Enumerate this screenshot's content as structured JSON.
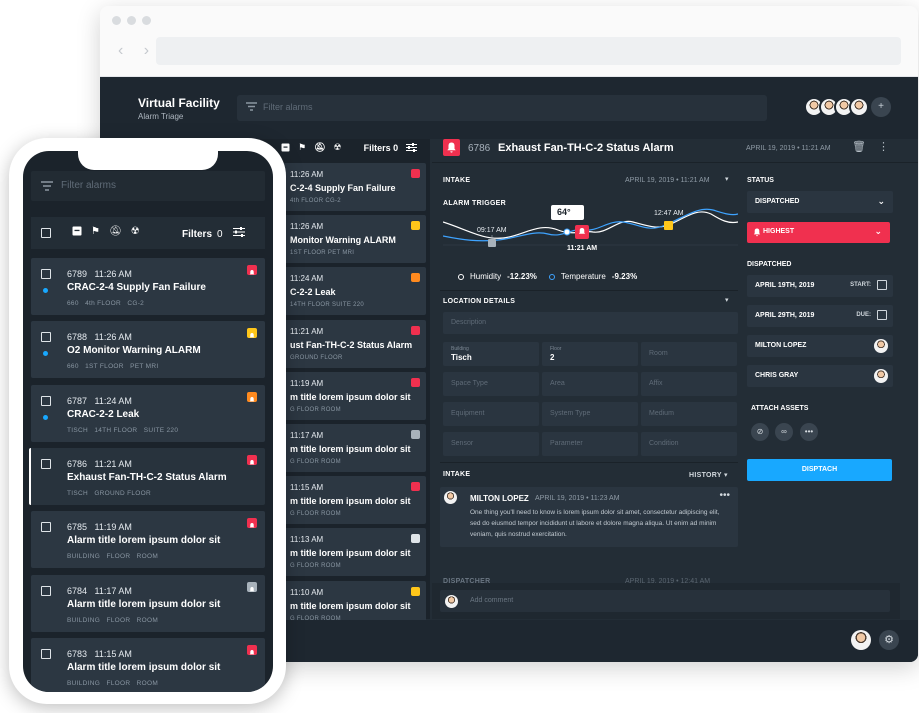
{
  "app": {
    "title": "Virtual Facility",
    "subtitle": "Alarm Triage",
    "filter_placeholder": "Filter alarms"
  },
  "toolbar": {
    "filters_label": "Filters",
    "filters_count": "0"
  },
  "alarms": [
    {
      "id": "6789",
      "time": "11:26 AM",
      "title": "CRAC-2-4 Supply Fan Failure",
      "meta": [
        "660",
        "4th FLOOR",
        "CG-2"
      ],
      "severity": "red",
      "unread": true
    },
    {
      "id": "6788",
      "time": "11:26 AM",
      "title": "O2 Monitor Warning ALARM",
      "meta": [
        "660",
        "1ST FLOOR",
        "PET MRI"
      ],
      "severity": "yellow",
      "unread": true
    },
    {
      "id": "6787",
      "time": "11:24 AM",
      "title": "CRAC-2-2 Leak",
      "meta": [
        "TISCH",
        "14TH FLOOR",
        "SUITE 220"
      ],
      "severity": "orange",
      "unread": true
    },
    {
      "id": "6786",
      "time": "11:21 AM",
      "title": "Exhaust Fan-TH-C-2 Status Alarm",
      "meta": [
        "TISCH",
        "GROUND FLOOR"
      ],
      "severity": "red",
      "unread": false,
      "selected": true
    },
    {
      "id": "6785",
      "time": "11:19 AM",
      "title": "Alarm title lorem ipsum dolor sit",
      "meta": [
        "BUILDING",
        "FLOOR",
        "ROOM"
      ],
      "severity": "red",
      "unread": false
    },
    {
      "id": "6784",
      "time": "11:17 AM",
      "title": "Alarm title lorem ipsum dolor sit",
      "meta": [
        "BUILDING",
        "FLOOR",
        "ROOM"
      ],
      "severity": "gray",
      "unread": false
    },
    {
      "id": "6783",
      "time": "11:15 AM",
      "title": "Alarm title lorem ipsum dolor sit",
      "meta": [
        "BUILDING",
        "FLOOR",
        "ROOM"
      ],
      "severity": "red",
      "unread": false
    }
  ],
  "bg_list": [
    {
      "time": "11:26 AM",
      "title": "C-2-4 Supply Fan Failure",
      "meta": "4th FLOOR   CG-2",
      "severity": "red"
    },
    {
      "time": "11:26 AM",
      "title": "Monitor Warning ALARM",
      "meta": "1ST FLOOR   PET MRI",
      "severity": "yellow"
    },
    {
      "time": "11:24 AM",
      "title": "C-2-2 Leak",
      "meta": "14TH FLOOR   SUITE 220",
      "severity": "orange"
    },
    {
      "time": "11:21 AM",
      "title": "ust Fan-TH-C-2 Status Alarm",
      "meta": "GROUND FLOOR",
      "severity": "red"
    },
    {
      "time": "11:19 AM",
      "title": "m title lorem ipsum dolor sit",
      "meta": "G   FLOOR   ROOM",
      "severity": "red"
    },
    {
      "time": "11:17 AM",
      "title": "m title lorem ipsum dolor sit",
      "meta": "G   FLOOR   ROOM",
      "severity": "gray"
    },
    {
      "time": "11:15 AM",
      "title": "m title lorem ipsum dolor sit",
      "meta": "G   FLOOR   ROOM",
      "severity": "red"
    },
    {
      "time": "11:13 AM",
      "title": "m title lorem ipsum dolor sit",
      "meta": "G   FLOOR   ROOM",
      "severity": "white"
    },
    {
      "time": "11:10 AM",
      "title": "m title lorem ipsum dolor sit",
      "meta": "G   FLOOR   ROOM",
      "severity": "yellow"
    }
  ],
  "detail": {
    "id": "6786",
    "title": "Exhaust Fan-TH-C-2 Status Alarm",
    "date": "APRIL 19, 2019  •  11:21 AM",
    "intake_label": "INTAKE",
    "intake_date": "APRIL 19, 2019  •  11:21 AM",
    "alarm_trigger_label": "ALARM TRIGGER",
    "chart": {
      "callout_value": "64°",
      "labels": {
        "start": "09:17 AM",
        "alarm": "11:21 AM",
        "end": "12:47 AM"
      }
    },
    "legend": {
      "humidity_label": "Humidity",
      "humidity_value": "-12.23%",
      "temperature_label": "Temperature",
      "temperature_value": "-9.23%"
    },
    "location_label": "LOCATION DETAILS",
    "description_placeholder": "Description",
    "fields": [
      {
        "label": "Building",
        "value": "Tisch"
      },
      {
        "label": "Floor",
        "value": "2"
      },
      {
        "label": "",
        "value": "",
        "placeholder": "Room"
      },
      {
        "label": "",
        "value": "",
        "placeholder": "Space Type"
      },
      {
        "label": "",
        "value": "",
        "placeholder": "Area"
      },
      {
        "label": "",
        "value": "",
        "placeholder": "Affix"
      },
      {
        "label": "",
        "value": "",
        "placeholder": "Equipment"
      },
      {
        "label": "",
        "value": "",
        "placeholder": "System Type"
      },
      {
        "label": "",
        "value": "",
        "placeholder": "Medium"
      },
      {
        "label": "",
        "value": "",
        "placeholder": "Sensor"
      },
      {
        "label": "",
        "value": "",
        "placeholder": "Parameter"
      },
      {
        "label": "",
        "value": "",
        "placeholder": "Condition"
      }
    ],
    "intake_section_label": "INTAKE",
    "history_label": "HISTORY",
    "comment": {
      "author": "MILTON LOPEZ",
      "date": "APRIL 19, 2019  •  11:23 AM",
      "text": "One thing you'll need to know is lorem ipsum dolor sit amet, consectetur adipiscing elit, sed do eiusmod tempor incididunt ut labore et dolore magna aliqua. Ut enim ad minim veniam, quis nostrud exercitation."
    },
    "dispatcher_label": "DISPATCHER",
    "dispatcher_date": "APRIL 19, 2019  •  12:41 AM",
    "add_comment_placeholder": "Add comment"
  },
  "status_panel": {
    "status_label": "STATUS",
    "status_value": "DISPATCHED",
    "priority_value": "HIGHEST",
    "dispatched_label": "DISPATCHED",
    "start_date": "APRIL 19TH, 2019",
    "start_label": "START:",
    "due_date": "APRIL 29TH, 2019",
    "due_label": "DUE:",
    "assignees": [
      "MILTON LOPEZ",
      "CHRIS GRAY"
    ],
    "attach_label": "ATTACH ASSETS",
    "dispatch_button": "DISPTACH"
  },
  "colors": {
    "red": "#f0304f",
    "yellow": "#ffc61a",
    "orange": "#ff8a1f",
    "gray": "#a8b2bb",
    "white": "#dfe4e8",
    "accent": "#18a8ff"
  },
  "icons": [
    "filter-icon",
    "archive-icon",
    "flag-icon",
    "bell-off-icon",
    "hazard-icon",
    "sliders-icon",
    "bell-icon",
    "trash-icon",
    "more-icon",
    "calendar-icon",
    "link-icon",
    "gear-icon",
    "add-user-icon",
    "chevron-down-icon"
  ]
}
